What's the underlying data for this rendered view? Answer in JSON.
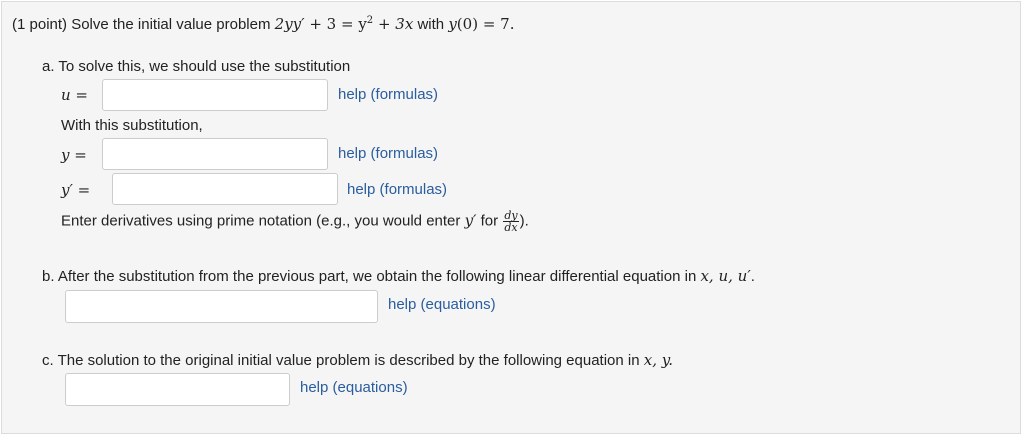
{
  "problem": {
    "prefix": "(1 point) Solve the initial value problem",
    "equation_lhs": "2yy",
    "equation_mid": " + 3 = y",
    "equation_exp": "2",
    "equation_rhs": " + 3x",
    "with_word": "with",
    "ic_func": "y",
    "ic_arg": "(0) = 7."
  },
  "part_a": {
    "intro": "a. To solve this, we should use the substitution",
    "u_label": "u =",
    "u_input": {
      "value": "",
      "placeholder": ""
    },
    "u_help": "help (formulas)",
    "with_sub": "With this substitution,",
    "y_label": "y =",
    "y_input": {
      "value": "",
      "placeholder": ""
    },
    "y_help": "help (formulas)",
    "yprime_label": "y",
    "yprime_eq": " =",
    "yprime_input": {
      "value": "",
      "placeholder": ""
    },
    "yprime_help": "help (formulas)",
    "deriv_note_pre": "Enter derivatives using prime notation (e.g., you would enter",
    "deriv_note_y": "y",
    "deriv_note_for": "for",
    "deriv_frac_num": "dy",
    "deriv_frac_den": "dx",
    "deriv_note_end": ")."
  },
  "part_b": {
    "text": "b. After the substitution from the previous part, we obtain the following linear differential equation in",
    "vars": "x, u, u",
    "end": ".",
    "input": {
      "value": "",
      "placeholder": ""
    },
    "help": "help (equations)"
  },
  "part_c": {
    "text": "c. The solution to the original initial value problem is described by the following equation in",
    "vars": "x, y.",
    "input": {
      "value": "",
      "placeholder": ""
    },
    "help": "help (equations)"
  },
  "prime": "′"
}
